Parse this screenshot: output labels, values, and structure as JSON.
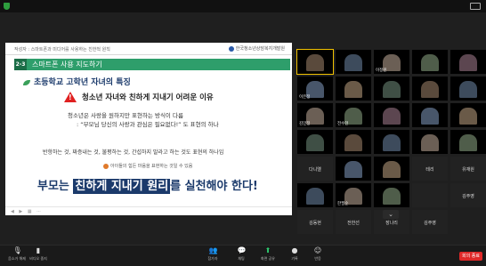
{
  "slide": {
    "series": "작성자 : 스마트폰과 미디어를 사용하는 친한척 원칙",
    "org": "한국청소년상담복지개발원",
    "section_number": "2-3",
    "section_title": "스마트폰 사용 지도하기",
    "subtitle": "초등학교 고학년 자녀의 특징",
    "warning": "청소년 자녀와 친하게 지내기 어려운 이유",
    "body_line1": "청소년은 사랑을 원하지만 표현하는 방식이 다름",
    "body_line2": ": “부모님 당신의 사랑과 관심은 필요없다!” 도 표현의 하나",
    "body_line3": "반항하는 것, 짜증내는 것, 불평하는 것, 간섭하지 말라고 하는 것도 표현의 하나임",
    "body_line4": "아이들의 힘든 마음을 표현하는 것일 수 있음",
    "big_prefix": "부모는",
    "big_highlight": "친하게 지내기 원리",
    "big_suffix": "를 실천해야 한다!",
    "controls": "◀ ▶ ▦ ⋯"
  },
  "participants": [
    {
      "name": "",
      "video": true,
      "active": true
    },
    {
      "name": "",
      "video": true
    },
    {
      "name": "이정원",
      "video": true
    },
    {
      "name": "",
      "video": true
    },
    {
      "name": "",
      "video": true
    },
    {
      "name": "이은정",
      "video": true
    },
    {
      "name": "",
      "video": true
    },
    {
      "name": "",
      "video": true
    },
    {
      "name": "",
      "video": true
    },
    {
      "name": "",
      "video": true
    },
    {
      "name": "김민정",
      "video": true
    },
    {
      "name": "전수현",
      "video": true
    },
    {
      "name": "",
      "video": true
    },
    {
      "name": "",
      "video": true
    },
    {
      "name": "",
      "video": true
    },
    {
      "name": "",
      "video": true
    },
    {
      "name": "",
      "video": true
    },
    {
      "name": "",
      "video": true
    },
    {
      "name": "",
      "video": true
    },
    {
      "name": "",
      "video": true
    },
    {
      "name": "다니엘",
      "video": false
    },
    {
      "name": "",
      "video": true
    },
    {
      "name": "",
      "video": true
    },
    {
      "name": "테리",
      "video": false
    },
    {
      "name": "유재원",
      "video": false
    },
    {
      "name": "",
      "video": true
    },
    {
      "name": "한필순",
      "video": true
    },
    {
      "name": "",
      "video": true
    },
    {
      "name": "",
      "video": false
    },
    {
      "name": "김주영",
      "video": false
    },
    {
      "name": "김동현",
      "video": false
    },
    {
      "name": "전한선",
      "video": false
    },
    {
      "name": "장나리",
      "video": false
    },
    {
      "name": "김주영",
      "video": false
    }
  ],
  "gallery_next": "⌄",
  "toolbar": {
    "mute": {
      "label": "음소거 해제",
      "icon": "microphone-icon"
    },
    "video": {
      "label": "비디오 중지",
      "icon": "camera-icon"
    },
    "participants": {
      "label": "참가자",
      "icon": "participants-icon"
    },
    "chat": {
      "label": "채팅",
      "icon": "chat-icon"
    },
    "share": {
      "label": "화면 공유",
      "icon": "share-screen-icon"
    },
    "record": {
      "label": "기록",
      "icon": "record-icon"
    },
    "reactions": {
      "label": "반응",
      "icon": "reaction-icon"
    },
    "end": "회의 종료"
  },
  "colors": {
    "band": "#2e9e6b",
    "navy": "#1b3a6b",
    "warning": "#e02020",
    "share_green": "#2ecc71",
    "end_red": "#e02828",
    "active_speaker": "#f2c200"
  }
}
